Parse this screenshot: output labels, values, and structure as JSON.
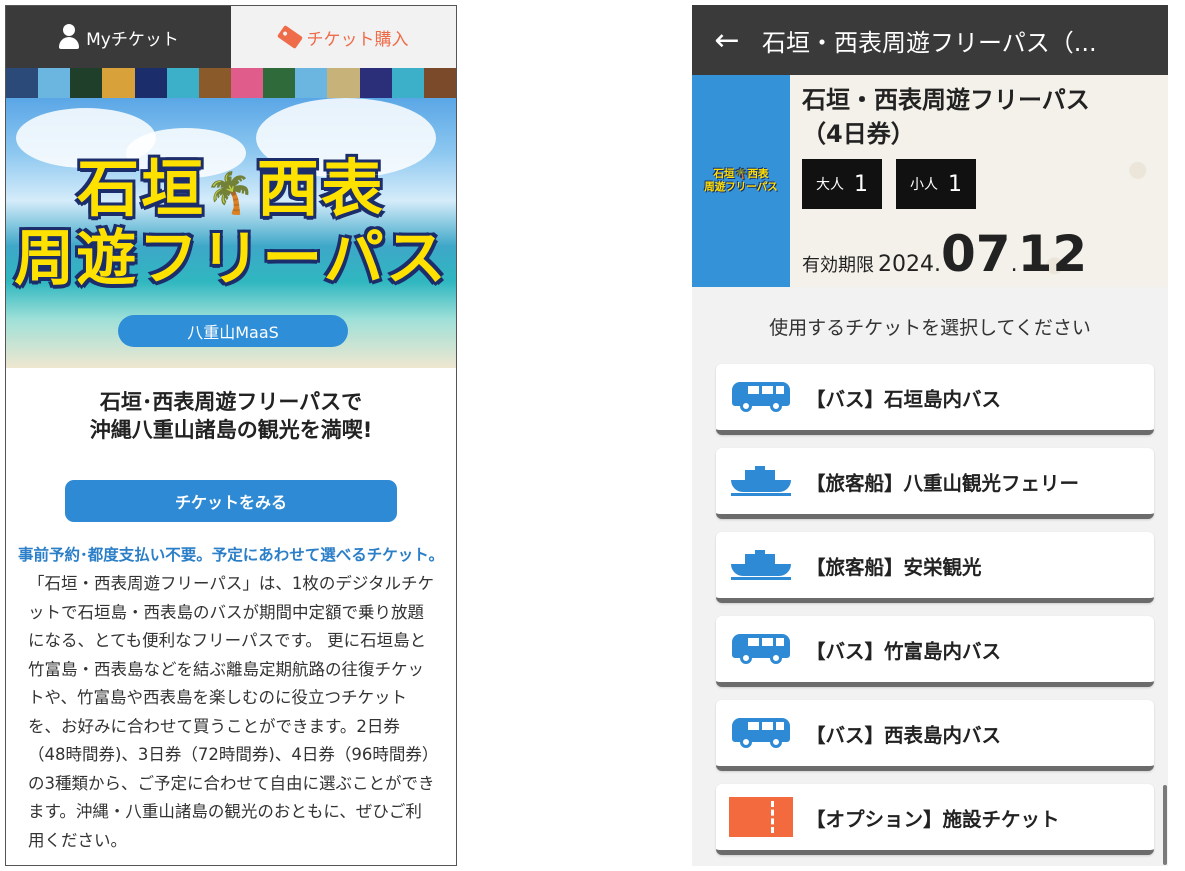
{
  "left": {
    "tabs": [
      {
        "label": "Myチケット",
        "icon": "person-icon",
        "active": true
      },
      {
        "label": "チケット購入",
        "icon": "ticket-icon",
        "active": false
      }
    ],
    "banner": {
      "line1a": "石垣",
      "line1b": "西表",
      "line2": "周遊フリーパス",
      "badge": "八重山MaaS"
    },
    "headline_1": "石垣･西表周遊フリーパスで",
    "headline_2": "沖縄八重山諸島の観光を満喫!",
    "view_button": "チケットをみる",
    "subheadline": "事前予約･都度支払い不要。予定にあわせて選べるチケット。",
    "description": "「石垣・西表周遊フリーパス」は、1枚のデジタルチケットで石垣島・西表島のバスが期間中定額で乗り放題になる、とても便利なフリーパスです。 更に石垣島と竹富島・西表島などを結ぶ離島定期航路の往復チケットや、竹富島や西表島を楽しむのに役立つチケットを、お好みに合わせて買うことができます。2日券（48時間券)、3日券（72時間券)、4日券（96時間券）の3種類から、ご予定に合わせて自由に選ぶことができます。沖縄・八重山諸島の観光のおともに、ぜひご利用ください。"
  },
  "right": {
    "title": "石垣・西表周遊フリーパス（...",
    "pass": {
      "logo_line1": "石垣🌴西表",
      "logo_line2": "周遊フリーパス",
      "name_line1": "石垣・西表周遊フリーパス",
      "name_line2": "（4日券）",
      "adult_label": "大人",
      "adult_count": "1",
      "child_label": "小人",
      "child_count": "1",
      "valid_label": "有効期限",
      "valid_year": "2024",
      "valid_month": "07",
      "valid_day": "12"
    },
    "select_prompt": "使用するチケットを選択してください",
    "items": [
      {
        "label": "【バス】石垣島内バス",
        "icon": "bus-icon"
      },
      {
        "label": "【旅客船】八重山観光フェリー",
        "icon": "ship-icon"
      },
      {
        "label": "【旅客船】安栄観光",
        "icon": "ship-icon"
      },
      {
        "label": "【バス】竹富島内バス",
        "icon": "bus-icon"
      },
      {
        "label": "【バス】西表島内バス",
        "icon": "bus-icon"
      },
      {
        "label": "【オプション】施設チケット",
        "icon": "ticket-icon"
      }
    ]
  },
  "colors": {
    "accent_blue": "#2e8ad4",
    "accent_orange": "#ef6c4a",
    "dark_bar": "#3a3a3a"
  }
}
